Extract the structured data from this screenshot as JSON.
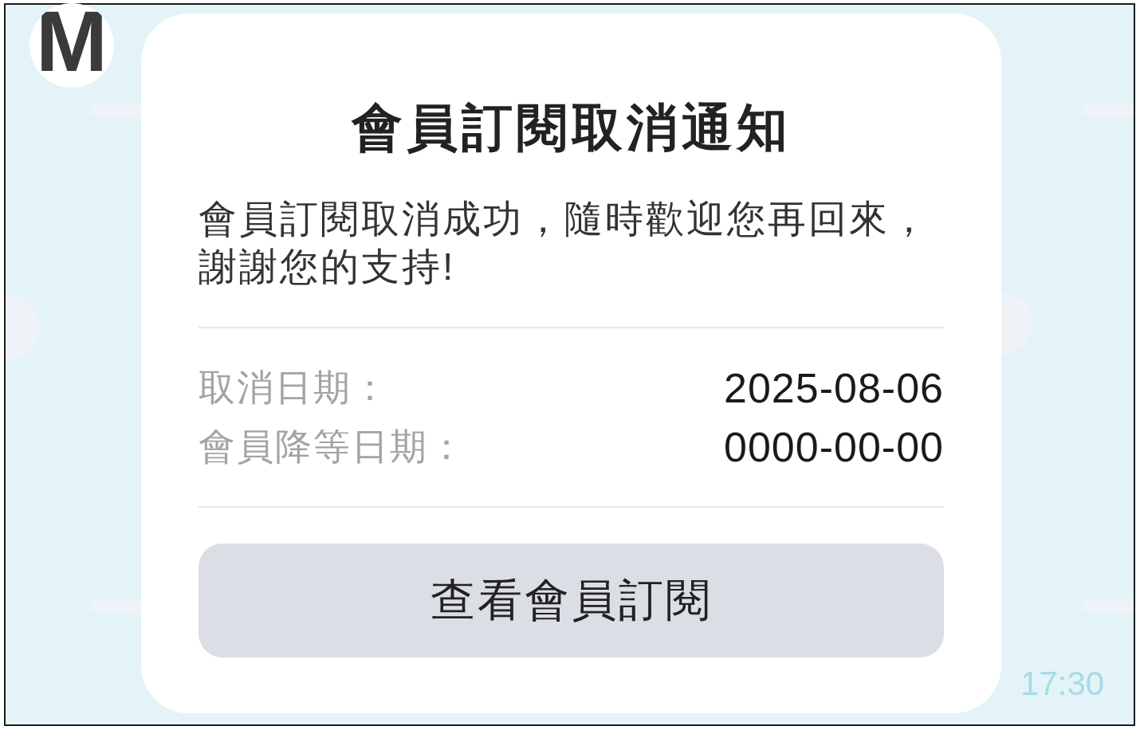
{
  "avatar": {
    "letter": "M"
  },
  "card": {
    "title": "會員訂閱取消通知",
    "message": "會員訂閱取消成功，隨時歡迎您再回來，謝謝您的支持!",
    "details": [
      {
        "label": "取消日期：",
        "value": "2025-08-06"
      },
      {
        "label": "會員降等日期：",
        "value": "0000-00-00"
      }
    ],
    "button": "查看會員訂閱"
  },
  "timestamp": "17:30"
}
